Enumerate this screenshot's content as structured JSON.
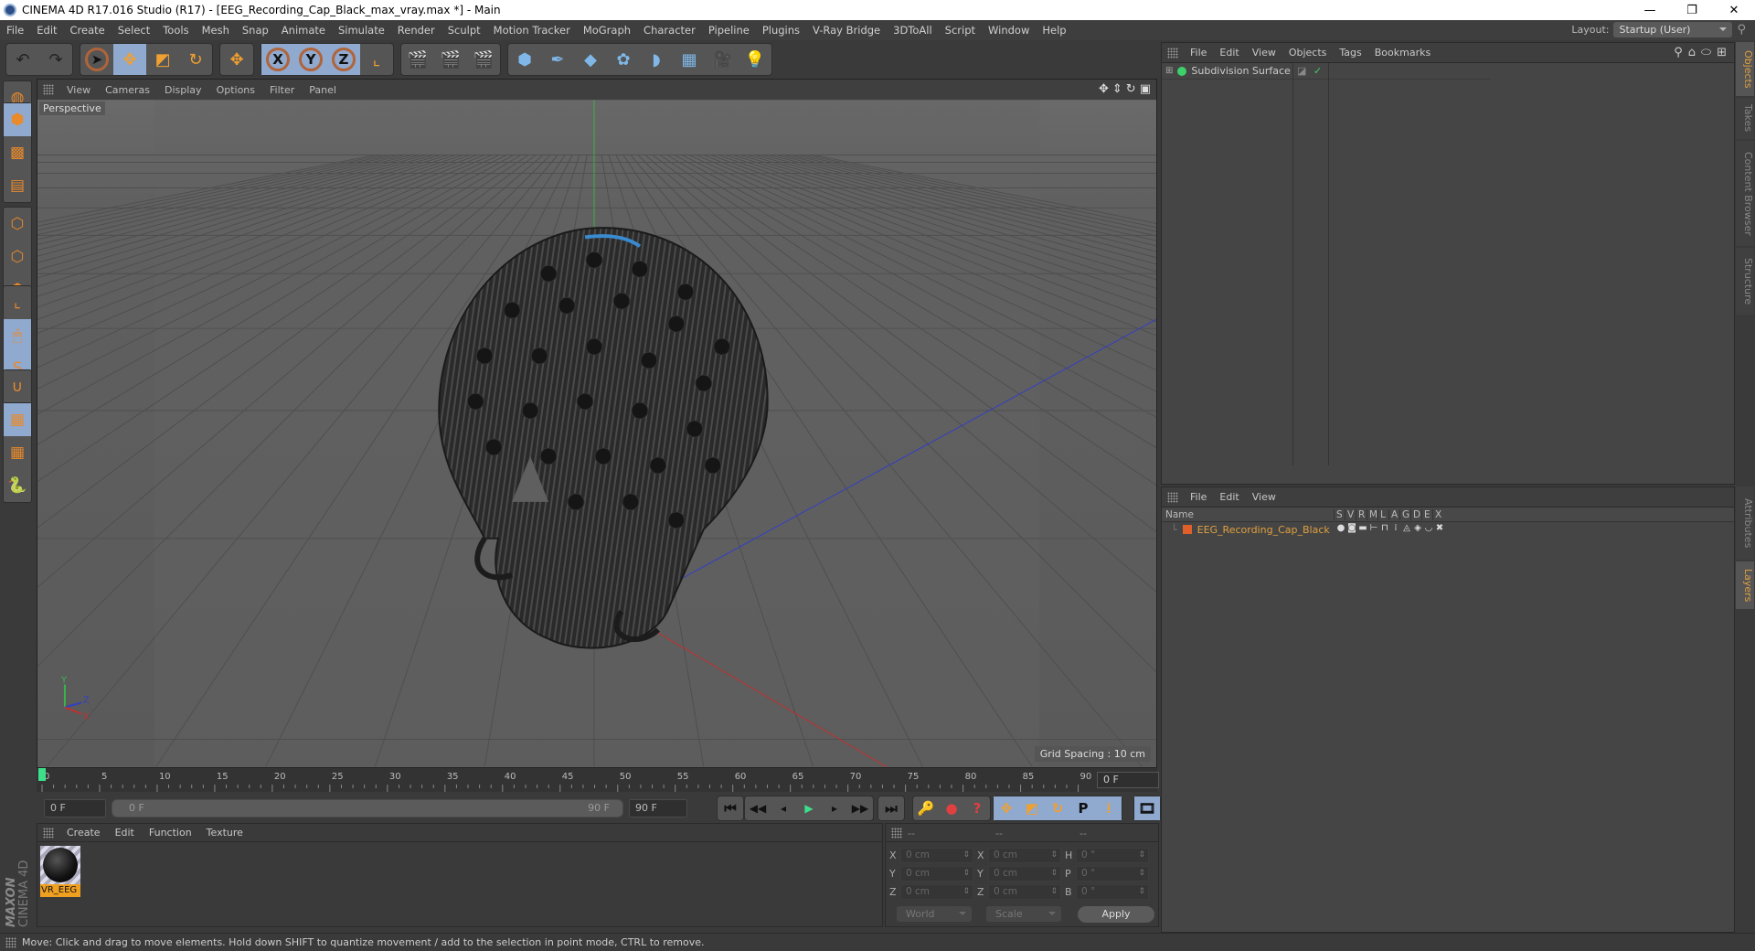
{
  "window": {
    "title": "CINEMA 4D R17.016 Studio (R17) - [EEG_Recording_Cap_Black_max_vray.max *] - Main",
    "controls": {
      "minimize": "—",
      "restore": "❐",
      "close": "✕"
    }
  },
  "menubar": {
    "items": [
      "File",
      "Edit",
      "Create",
      "Select",
      "Tools",
      "Mesh",
      "Snap",
      "Animate",
      "Simulate",
      "Render",
      "Sculpt",
      "Motion Tracker",
      "MoGraph",
      "Character",
      "Pipeline",
      "Plugins",
      "V-Ray Bridge",
      "3DToAll",
      "Script",
      "Window",
      "Help"
    ],
    "layout_label": "Layout:",
    "layout_value": "Startup (User)"
  },
  "toolbar": {
    "groups": [
      [
        {
          "name": "undo",
          "glyph": "↶"
        },
        {
          "name": "redo",
          "glyph": "↷"
        }
      ],
      [
        {
          "name": "live-selection",
          "glyph": "➤",
          "active": false
        },
        {
          "name": "move",
          "glyph": "✥",
          "active": true
        },
        {
          "name": "scale",
          "glyph": "◩"
        },
        {
          "name": "rotate",
          "glyph": "↻"
        }
      ],
      [
        {
          "name": "last-tool",
          "glyph": "✥"
        }
      ],
      [
        {
          "name": "x-axis",
          "glyph": "X",
          "active": true
        },
        {
          "name": "y-axis",
          "glyph": "Y",
          "active": true
        },
        {
          "name": "z-axis",
          "glyph": "Z",
          "active": true
        },
        {
          "name": "coordinate-system",
          "glyph": "⌞"
        }
      ],
      [
        {
          "name": "render-view",
          "glyph": "🎬"
        },
        {
          "name": "render-to-picture-viewer",
          "glyph": "🎬"
        },
        {
          "name": "render-settings",
          "glyph": "🎬"
        }
      ],
      [
        {
          "name": "cube",
          "glyph": "⬢"
        },
        {
          "name": "pen",
          "glyph": "✒"
        },
        {
          "name": "subdivision-surface",
          "glyph": "◆"
        },
        {
          "name": "cloner",
          "glyph": "✿"
        },
        {
          "name": "deformer",
          "glyph": "◗"
        },
        {
          "name": "floor",
          "glyph": "▦"
        },
        {
          "name": "camera",
          "glyph": "🎥"
        },
        {
          "name": "light",
          "glyph": "💡"
        }
      ]
    ]
  },
  "left_tools": [
    {
      "name": "make-editable",
      "glyph": "◍"
    },
    {
      "name": "model-mode",
      "glyph": "⬢",
      "active": true
    },
    {
      "name": "texture-mode",
      "glyph": "▩"
    },
    {
      "name": "workplane-mode",
      "glyph": "▤"
    },
    {
      "name": "points-mode",
      "glyph": "⬡"
    },
    {
      "name": "edges-mode",
      "glyph": "⬡"
    },
    {
      "name": "polygons-mode",
      "glyph": "⬢"
    },
    {
      "name": "axis-mode",
      "glyph": "⌞"
    },
    {
      "name": "tweak-mode",
      "glyph": "🖱",
      "active": true
    },
    {
      "name": "solo",
      "glyph": "S",
      "active": true
    },
    {
      "name": "snap",
      "glyph": "∪"
    },
    {
      "name": "workplane-lock",
      "glyph": "▦",
      "active": true
    },
    {
      "name": "workplane-align",
      "glyph": "▦"
    },
    {
      "name": "python",
      "glyph": "🐍"
    }
  ],
  "viewport": {
    "menu": [
      "View",
      "Cameras",
      "Display",
      "Options",
      "Filter",
      "Panel"
    ],
    "camera_label": "Perspective",
    "grid_spacing": "Grid Spacing : 10 cm",
    "axis_labels": {
      "x": "X",
      "y": "Y",
      "z": "Z"
    }
  },
  "timeline": {
    "ticks": [
      "0",
      "5",
      "10",
      "15",
      "20",
      "25",
      "30",
      "35",
      "40",
      "45",
      "50",
      "55",
      "60",
      "65",
      "70",
      "75",
      "80",
      "85",
      "90"
    ],
    "current_frame_field": "0 F",
    "start_field": "0 F",
    "range_start": "0 F",
    "range_end": "90 F",
    "end_field": "90 F",
    "current_frame": 0,
    "max_frame": 90
  },
  "transport": {
    "buttons": [
      {
        "name": "go-to-start",
        "glyph": "⏮"
      },
      {
        "name": "previous-key",
        "glyph": "◀◀"
      },
      {
        "name": "previous-frame",
        "glyph": "◂"
      },
      {
        "name": "play",
        "glyph": "▶"
      },
      {
        "name": "next-frame",
        "glyph": "▸"
      },
      {
        "name": "next-key",
        "glyph": "▶▶"
      },
      {
        "name": "go-to-end",
        "glyph": "⏭"
      }
    ],
    "record": [
      {
        "name": "keyframe-selection",
        "glyph": "🔑"
      },
      {
        "name": "autokeying",
        "glyph": "●"
      },
      {
        "name": "record-help",
        "glyph": "?"
      }
    ],
    "key_types": [
      {
        "name": "position-key",
        "glyph": "✥"
      },
      {
        "name": "scale-key",
        "glyph": "◩"
      },
      {
        "name": "rotation-key",
        "glyph": "↻"
      },
      {
        "name": "parameter-key",
        "glyph": "P"
      },
      {
        "name": "point-level-key",
        "glyph": "⁞"
      }
    ],
    "timeline_button": {
      "name": "timeline-window",
      "glyph": "🎞"
    }
  },
  "material_panel": {
    "menu": [
      "Create",
      "Edit",
      "Function",
      "Texture"
    ],
    "materials": [
      {
        "name": "VR_EEG"
      }
    ],
    "brand_top": "MAXON",
    "brand_bottom": "CINEMA 4D"
  },
  "coordinates": {
    "headers": [
      "--",
      "--",
      "--"
    ],
    "rows": [
      {
        "l1": "X",
        "v1": "0 cm",
        "l2": "X",
        "v2": "0 cm",
        "l3": "H",
        "v3": "0 °"
      },
      {
        "l1": "Y",
        "v1": "0 cm",
        "l2": "Y",
        "v2": "0 cm",
        "l3": "P",
        "v3": "0 °"
      },
      {
        "l1": "Z",
        "v1": "0 cm",
        "l2": "Z",
        "v2": "0 cm",
        "l3": "B",
        "v3": "0 °"
      }
    ],
    "mode": "World",
    "transform": "Scale",
    "apply_label": "Apply"
  },
  "object_manager": {
    "menu": [
      "File",
      "Edit",
      "View",
      "Objects",
      "Tags",
      "Bookmarks"
    ],
    "objects": [
      {
        "name": "Subdivision Surface"
      }
    ]
  },
  "layer_manager": {
    "menu": [
      "File",
      "Edit",
      "View"
    ],
    "columns": [
      "Name",
      "S",
      "V",
      "R",
      "M",
      "L",
      "A",
      "G",
      "D",
      "E",
      "X"
    ],
    "layers": [
      {
        "name": "EEG_Recording_Cap_Black",
        "color": "#e0602a"
      }
    ]
  },
  "right_tabs": {
    "top": [
      {
        "label": "Objects",
        "active": true
      },
      {
        "label": "Takes"
      },
      {
        "label": "Content Browser"
      },
      {
        "label": "Structure"
      }
    ],
    "bottom": [
      {
        "label": "Attributes"
      },
      {
        "label": "Layers",
        "active": true
      }
    ]
  },
  "status": {
    "text": "Move: Click and drag to move elements. Hold down SHIFT to quantize movement / add to the selection in point mode, CTRL to remove."
  },
  "colors": {
    "accent_orange": "#e98a2b",
    "active_blue": "#8fa9cf",
    "layer_name": "#e0a040",
    "play_green": "#3de08a"
  }
}
